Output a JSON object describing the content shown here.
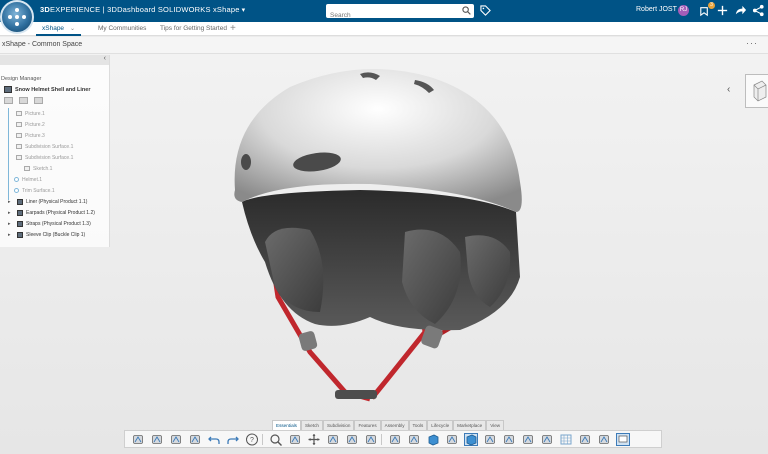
{
  "topbar": {
    "brand_bold": "3D",
    "brand_rest": "EXPERIENCE",
    "separator": " | ",
    "app_name": "3DDashboard  SOLIDWORKS xShape",
    "search_placeholder": "Search",
    "user_name": "Robert JOST",
    "avatar_initials": "RJ",
    "notification_count": "3",
    "colors": {
      "bar": "#005386",
      "avatar": "#a35db8",
      "badge": "#e8a33a"
    }
  },
  "tabs": [
    {
      "label": "xShape",
      "active": true
    },
    {
      "label": "My Communities",
      "active": false
    },
    {
      "label": "Tips for Getting Started",
      "active": false
    }
  ],
  "breadcrumb": "xShape - Common Space",
  "more_label": "···",
  "panel": {
    "title": "Design Manager",
    "root": "Snow Helmet Shell and Liner",
    "nodes": [
      {
        "label": "Picture.1"
      },
      {
        "label": "Picture.2"
      },
      {
        "label": "Picture.3"
      },
      {
        "label": "Subdivision Surface.1"
      },
      {
        "label": "Subdivision Surface.1"
      },
      {
        "label": "Sketch.1"
      },
      {
        "label": "Helmet.1"
      },
      {
        "label": "Trim Surface.1"
      }
    ],
    "products": [
      {
        "label": "Liner (Physical Product 1.1)"
      },
      {
        "label": "Earpads (Physical Product 1.2)"
      },
      {
        "label": "Straps (Physical Product 1.3)"
      },
      {
        "label": "Sleeve Clip (Buckle Clip 1)"
      }
    ]
  },
  "action_tabs": [
    {
      "label": "Essentials",
      "active": true
    },
    {
      "label": "Sketch",
      "active": false
    },
    {
      "label": "Subdivision",
      "active": false
    },
    {
      "label": "Features",
      "active": false
    },
    {
      "label": "Assembly",
      "active": false
    },
    {
      "label": "Tools",
      "active": false
    },
    {
      "label": "Lifecycle",
      "active": false
    },
    {
      "label": "Marketplace",
      "active": false
    },
    {
      "label": "View",
      "active": false
    }
  ],
  "action_buttons": [
    "new-part-icon",
    "save-icon",
    "share-icon",
    "cycle-icon",
    "undo-icon",
    "redo-icon",
    "help-icon",
    "zoom-icon",
    "fit-all-icon",
    "pan-icon",
    "rotate-icon",
    "zoom-area-icon",
    "normal-view-icon",
    "iso-view-icon",
    "cylinder-icon",
    "cube-icon",
    "cylinder-2-icon",
    "cube-shaded-icon",
    "cube-wire-icon",
    "render-icon",
    "ambient-icon",
    "material-icon",
    "grid-icon",
    "section-icon",
    "capture-icon",
    "display-icon"
  ]
}
